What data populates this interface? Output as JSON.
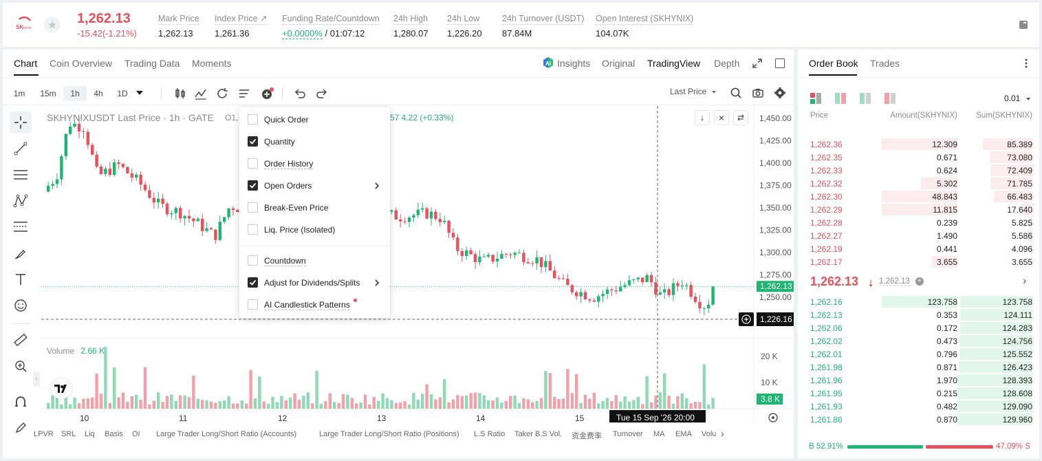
{
  "header": {
    "price": "1,262.13",
    "change": "-15.42(-1.21%)",
    "stats": [
      {
        "label": "Mark Price",
        "value": "1,262.13"
      },
      {
        "label": "Index Price ↗",
        "value": "1,261.36"
      },
      {
        "label": "Funding Rate/Countdown",
        "value_green": "+0.0000%",
        "value": " / 01:07:12"
      },
      {
        "label": "24h High",
        "value": "1,280.07"
      },
      {
        "label": "24h Low",
        "value": "1,226.20"
      },
      {
        "label": "24h Turnover (USDT)",
        "value": "87.84M"
      },
      {
        "label": "Open Interest (SKHYNIX)",
        "value": "104.07K"
      }
    ]
  },
  "chart_tabs": [
    "Chart",
    "Coin Overview",
    "Trading Data",
    "Moments"
  ],
  "view_tabs": {
    "insights": "Insights",
    "original": "Original",
    "tradingview": "TradingView",
    "depth": "Depth"
  },
  "timeframes": [
    "1m",
    "15m",
    "1h",
    "4h",
    "1D"
  ],
  "price_type": "Last Price",
  "chart_header": {
    "symbol": "SKHYNIXUSDT Last Price · 1h · GATE",
    "o_label": "O1,",
    "change": "57  4.22 (+0.33%)"
  },
  "volume": {
    "label": "Volume",
    "value": "2.66 K"
  },
  "price_axis": [
    "1,450.00",
    "1,425.00",
    "1,400.00",
    "1,375.00",
    "1,350.00",
    "1,325.00",
    "1,300.00",
    "1,275.00",
    "1,250.00"
  ],
  "last_price_tag": "1,262.13",
  "crosshair_price": "1,226.16",
  "volume_axis": [
    "20 K",
    "10 K"
  ],
  "volume_tag": "3.8 K",
  "date_axis": [
    "10",
    "11",
    "12",
    "13",
    "14",
    "15"
  ],
  "crosshair_date": "Tue 15 Sep '26   20:00",
  "indicators": [
    "LPVR",
    "SRL",
    "Liq",
    "Basis",
    "OI",
    "Large Trader Long/Short Ratio (Accounts)",
    "Large Trader Long/Short Ratio (Positions)",
    "L.S Ratio",
    "Taker B.S Vol.",
    "资金费率",
    "Turnover",
    "MA",
    "EMA",
    "Volu"
  ],
  "menu": {
    "items": [
      {
        "label": "Quick Order",
        "checked": false
      },
      {
        "label": "Quantity",
        "checked": true
      },
      {
        "label": "Order History",
        "checked": false
      },
      {
        "label": "Open Orders",
        "checked": true
      },
      {
        "label": "Break-Even Price",
        "checked": false
      },
      {
        "label": "Liq. Price (Isolated)",
        "checked": false
      }
    ],
    "items2": [
      {
        "label": "Countdown",
        "checked": false
      },
      {
        "label": "Adjust for Dividends/Splits",
        "checked": true
      },
      {
        "label": "AI Candlestick Patterns",
        "checked": false
      }
    ]
  },
  "orderbook": {
    "tabs": [
      "Order Book",
      "Trades"
    ],
    "precision": "0.01",
    "columns": [
      "Price",
      "Amount(SKHYNIX)",
      "Sum(SKHYNIX)"
    ],
    "asks": [
      [
        "1,262.36",
        "12.309",
        "85.389"
      ],
      [
        "1,262.35",
        "0.671",
        "73.080"
      ],
      [
        "1,262.33",
        "0.624",
        "72.409"
      ],
      [
        "1,262.32",
        "5.302",
        "71.785"
      ],
      [
        "1,262.30",
        "48.843",
        "66.483"
      ],
      [
        "1,262.29",
        "11.815",
        "17.640"
      ],
      [
        "1,262.28",
        "0.239",
        "5.825"
      ],
      [
        "1,262.27",
        "1.490",
        "5.586"
      ],
      [
        "1,262.19",
        "0.441",
        "4.096"
      ],
      [
        "1,262.17",
        "3.655",
        "3.655"
      ]
    ],
    "mid_price": "1,262.13",
    "mid_mark": "1,262.13",
    "bids": [
      [
        "1,262.16",
        "123.758",
        "123.758"
      ],
      [
        "1,262.13",
        "0.353",
        "124.111"
      ],
      [
        "1,262.06",
        "0.172",
        "124.283"
      ],
      [
        "1,262.02",
        "0.473",
        "124.756"
      ],
      [
        "1,262.01",
        "0.796",
        "125.552"
      ],
      [
        "1,261.98",
        "0.871",
        "126.423"
      ],
      [
        "1,261.96",
        "1.970",
        "128.393"
      ],
      [
        "1,261.95",
        "0.215",
        "128.608"
      ],
      [
        "1,261.93",
        "0.482",
        "129.090"
      ],
      [
        "1,261.86",
        "0.870",
        "129.960"
      ]
    ],
    "buy_ratio": "B 52.91%",
    "sell_ratio": "47.09% S",
    "buy_fraction": 0.5291
  },
  "colors": {
    "up": "#21b573",
    "down": "#e8505b",
    "up_vol": "#8fd9b6",
    "down_vol": "#f2a1a8"
  }
}
